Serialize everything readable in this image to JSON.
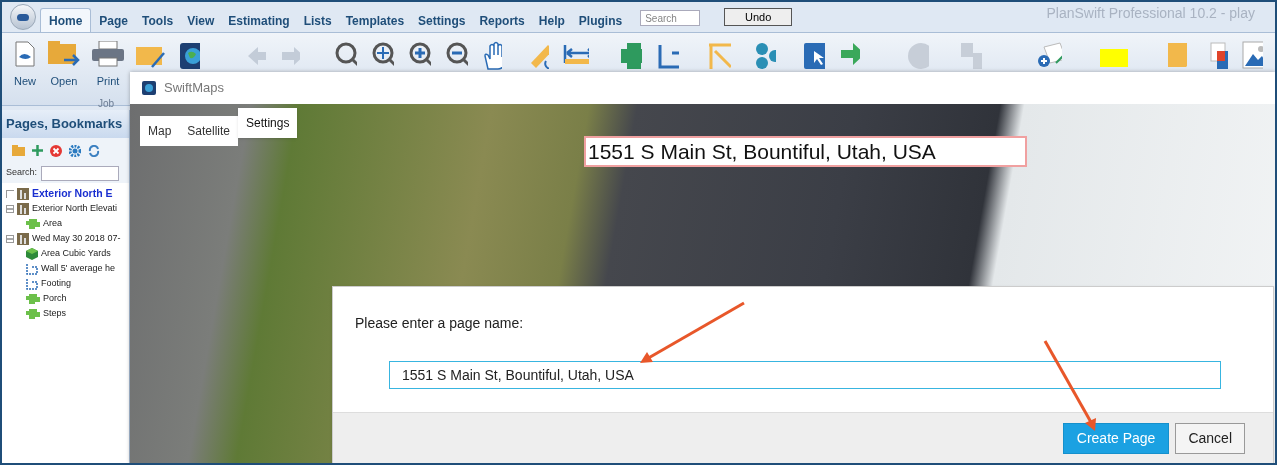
{
  "window": {
    "title": "PlanSwift Professional 10.2 - play"
  },
  "menu_tabs": [
    {
      "label": "Home",
      "selected": true
    },
    {
      "label": "Page",
      "selected": false
    },
    {
      "label": "Tools",
      "selected": false
    },
    {
      "label": "View",
      "selected": false
    },
    {
      "label": "Estimating",
      "selected": false
    },
    {
      "label": "Lists",
      "selected": false
    },
    {
      "label": "Templates",
      "selected": false
    },
    {
      "label": "Settings",
      "selected": false
    },
    {
      "label": "Reports",
      "selected": false
    },
    {
      "label": "Help",
      "selected": false
    },
    {
      "label": "Plugins",
      "selected": false
    }
  ],
  "search": {
    "placeholder": "Search"
  },
  "undo_button": "Undo",
  "ribbon": {
    "buttons": [
      {
        "label": "New"
      },
      {
        "label": "Open"
      },
      {
        "label": "Print"
      }
    ],
    "group": "Job"
  },
  "pages_panel": {
    "title": "Pages, Bookmarks",
    "search_label": "Search:",
    "tree": [
      {
        "label": "Exterior North E",
        "kind": "page",
        "selected": true
      },
      {
        "label": "Exterior North Elevati",
        "kind": "page",
        "selected": false,
        "expanded": true,
        "children": [
          {
            "label": "Area",
            "kind": "area",
            "selected": false
          }
        ]
      },
      {
        "label": "Wed May 30 2018 07-",
        "kind": "page",
        "selected": false,
        "expanded": true,
        "children": [
          {
            "label": "Area Cubic Yards",
            "kind": "volume",
            "selected": false
          },
          {
            "label": "Wall 5' average he",
            "kind": "linear",
            "selected": false
          },
          {
            "label": "Footing",
            "kind": "linear",
            "selected": false
          },
          {
            "label": "Porch",
            "kind": "area",
            "selected": false
          },
          {
            "label": "Steps",
            "kind": "area",
            "selected": false
          }
        ]
      }
    ]
  },
  "swiftmaps": {
    "title": "SwiftMaps",
    "map_tabs": [
      {
        "label": "Map",
        "selected": false
      },
      {
        "label": "Satellite",
        "selected": false
      },
      {
        "label": "Settings",
        "selected": true
      }
    ],
    "address": "1551 S Main St, Bountiful, Utah, USA",
    "dialog": {
      "prompt": "Please enter a page name:",
      "value": "1551 S Main St, Bountiful, Utah, USA",
      "buttons": [
        {
          "label": "Create Page",
          "primary": true
        },
        {
          "label": "Cancel",
          "primary": false
        }
      ]
    }
  }
}
